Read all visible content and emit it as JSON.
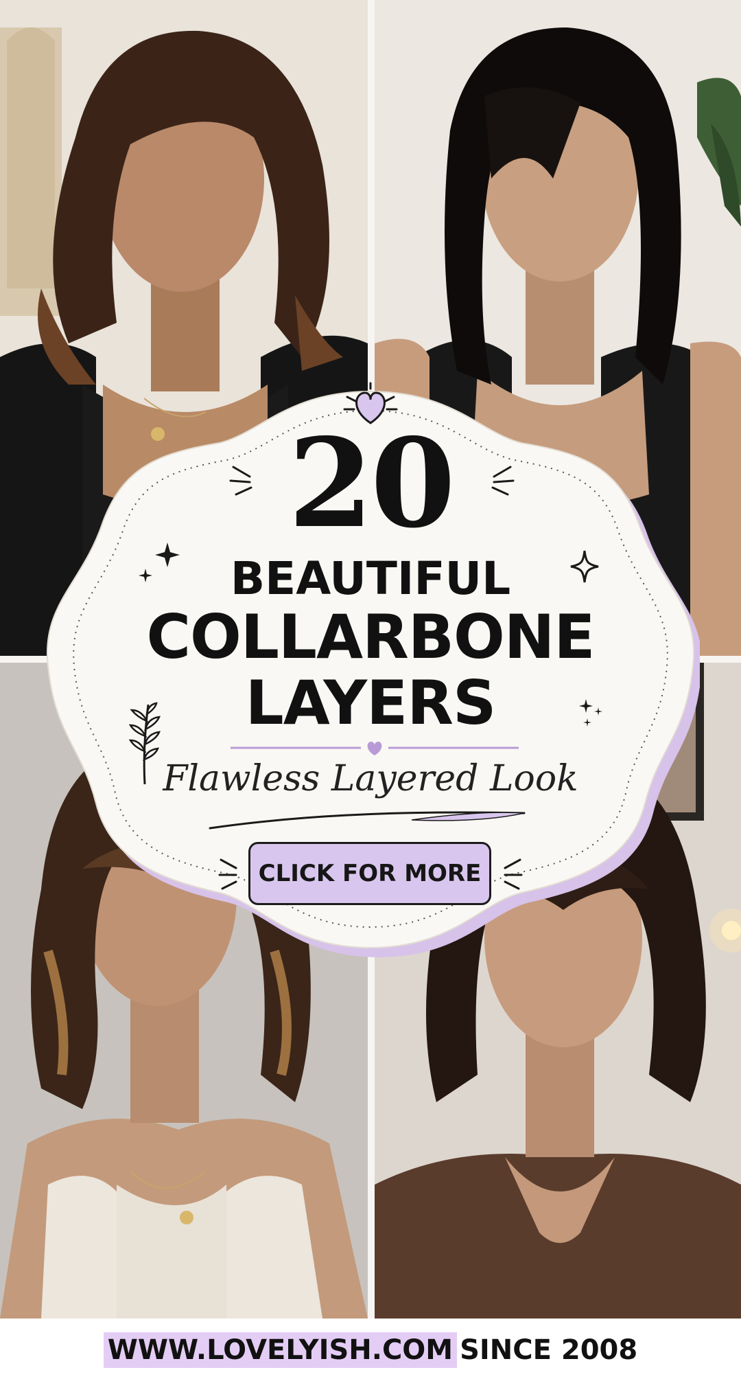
{
  "title": {
    "count": "20",
    "line1": "BEAUTIFUL",
    "line2": "COLLARBONE",
    "line3": "LAYERS"
  },
  "subtitle": "Flawless Layered Look",
  "cta_label": "CLICK FOR MORE",
  "footer": {
    "url": "WWW.LOVELYISH.COM",
    "since": "SINCE 2008"
  },
  "photos": [
    "woman-with-layered-brown-hair-black-top",
    "woman-with-straight-black-layers-black-tank",
    "woman-with-wavy-balayage-bangs-white-tank",
    "woman-with-curtain-bangs-brown-sweater"
  ],
  "colors": {
    "accent_lavender": "#d9c6ee",
    "badge_fill": "#faf8f4",
    "ink": "#111111"
  }
}
